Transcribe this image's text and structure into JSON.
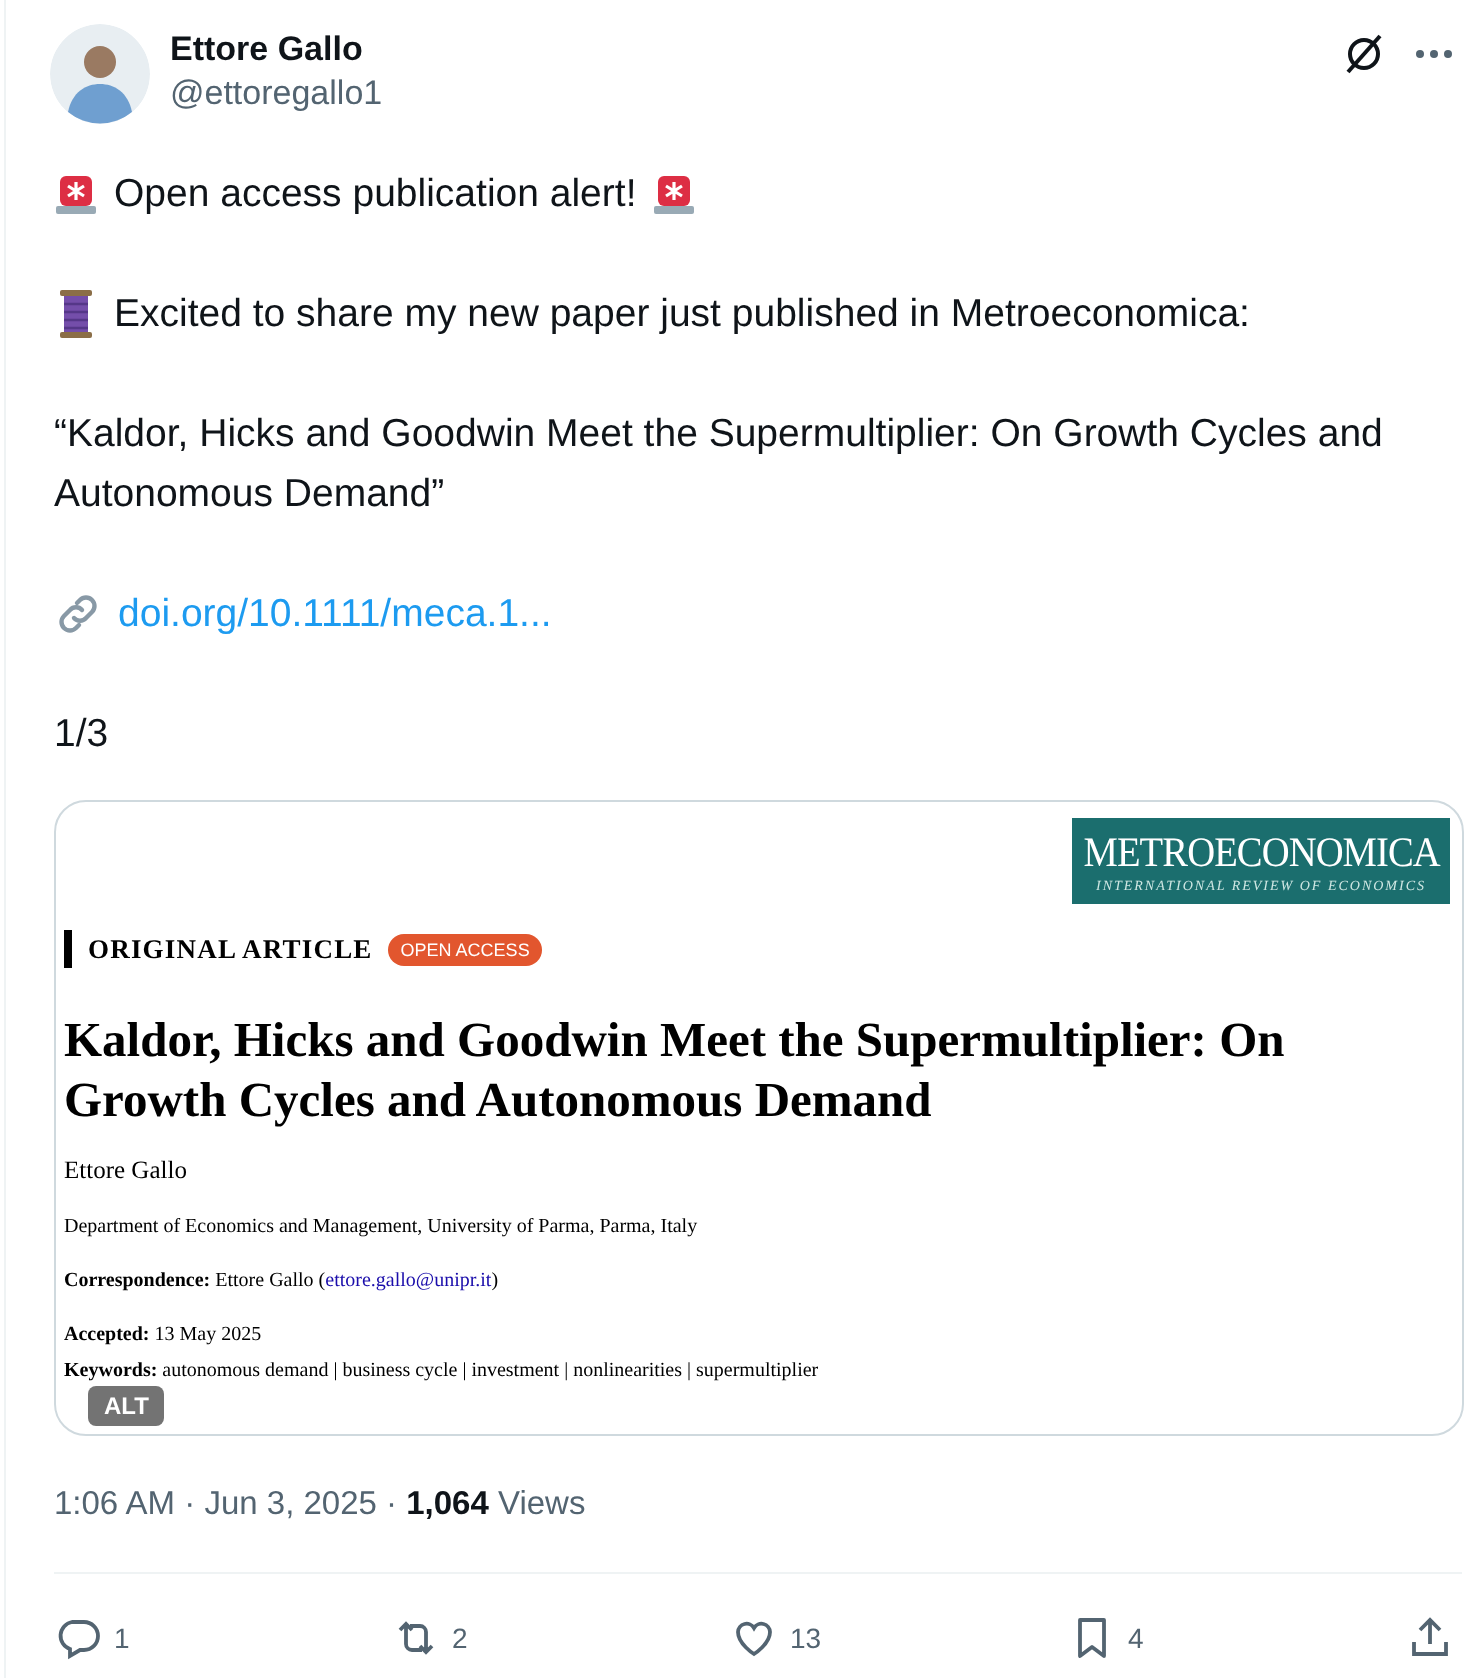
{
  "author": {
    "name": "Ettore Gallo",
    "handle": "@ettoregallo1"
  },
  "paragraphs": [
    {
      "kind": "alert",
      "text": "Open access publication alert!"
    },
    {
      "kind": "thread",
      "text": "Excited to share my new paper just published in Metroeconomica:"
    },
    {
      "kind": "plain",
      "text": "“Kaldor, Hicks and Goodwin Meet the Supermultiplier: On Growth Cycles and Autonomous Demand”"
    },
    {
      "kind": "link",
      "text": "doi.org/10.1111/meca.1..."
    },
    {
      "kind": "plain",
      "text": "1/3"
    }
  ],
  "media": {
    "logo_title": "METROECONOMICA",
    "logo_subtitle": "INTERNATIONAL REVIEW OF ECONOMICS",
    "section": "ORIGINAL ARTICLE",
    "badge": "OPEN ACCESS",
    "title": "Kaldor, Hicks and Goodwin Meet the Supermultiplier: On Growth Cycles and Autonomous Demand",
    "author": "Ettore Gallo",
    "affiliation": "Department of Economics and Management, University of Parma, Parma, Italy",
    "correspondence": {
      "text": "**Correspondence:** Ettore Gallo (",
      "email": "ettore.gallo@unipr.it",
      "close": ")"
    },
    "accepted": "**Accepted:** 13 May 2025",
    "keywords": "**Keywords:** autonomous demand | business cycle | investment | nonlinearities | supermultiplier",
    "alt_badge": "ALT"
  },
  "meta": "1:06 AM · Jun 3, 2025 · **1,064** Views",
  "actions": [
    {
      "kind": "reply",
      "count": "1"
    },
    {
      "kind": "repost",
      "count": "2"
    },
    {
      "kind": "like",
      "count": "13"
    },
    {
      "kind": "bookmark",
      "count": "4"
    },
    {
      "kind": "share"
    }
  ]
}
